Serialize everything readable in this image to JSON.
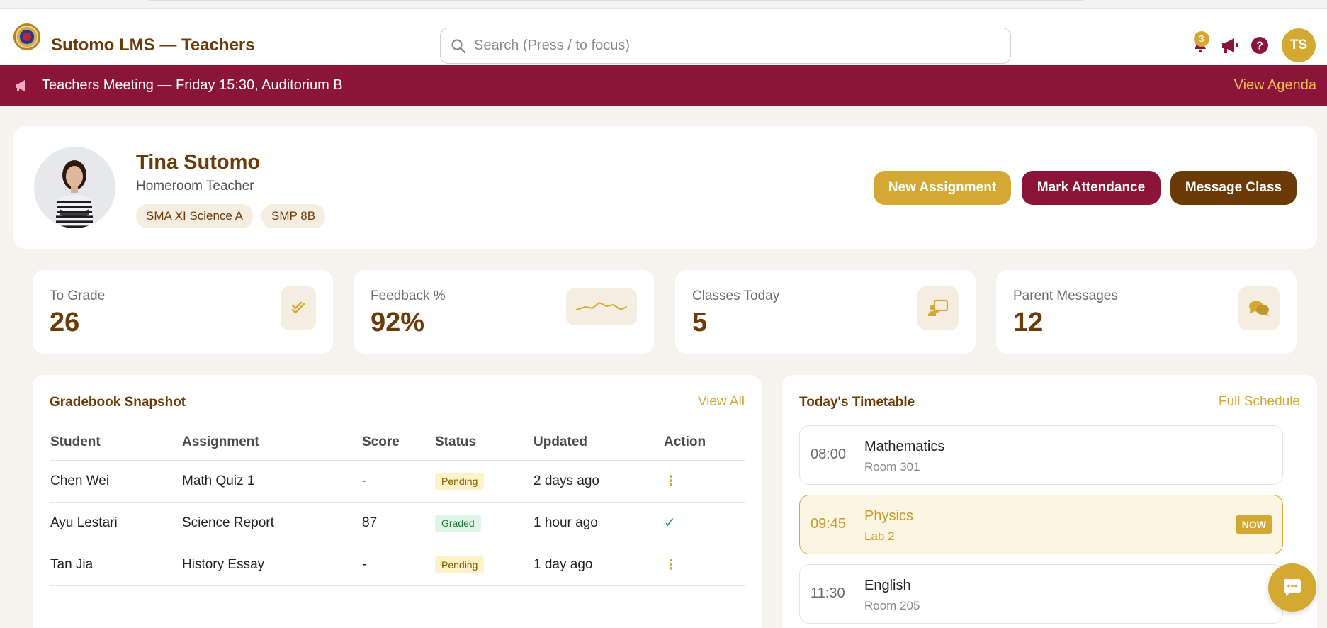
{
  "header": {
    "app_title": "Sutomo LMS — Teachers",
    "search_placeholder": "Search (Press / to focus)",
    "notification_count": "3",
    "user_initials": "TS"
  },
  "announcement": {
    "text": "Teachers Meeting — Friday 15:30, Auditorium B",
    "link": "View Agenda"
  },
  "profile": {
    "name": "Tina Sutomo",
    "role": "Homeroom Teacher",
    "classes": [
      "SMA XI Science A",
      "SMP 8B"
    ],
    "actions": {
      "new_assignment": "New Assignment",
      "mark_attendance": "Mark Attendance",
      "message_class": "Message Class"
    }
  },
  "stats": [
    {
      "label": "To Grade",
      "value": "26",
      "icon": "double-check-icon"
    },
    {
      "label": "Feedback %",
      "value": "92%",
      "icon": "sparkline-icon"
    },
    {
      "label": "Classes Today",
      "value": "5",
      "icon": "teacher-board-icon"
    },
    {
      "label": "Parent Messages",
      "value": "12",
      "icon": "chat-bubbles-icon"
    }
  ],
  "gradebook": {
    "title": "Gradebook Snapshot",
    "link": "View All",
    "columns": [
      "Student",
      "Assignment",
      "Score",
      "Status",
      "Updated",
      "Action"
    ],
    "rows": [
      {
        "student": "Chen Wei",
        "assignment": "Math Quiz 1",
        "score": "-",
        "status": "Pending",
        "updated": "2 days ago",
        "action": "kebab-icon"
      },
      {
        "student": "Ayu Lestari",
        "assignment": "Science Report",
        "score": "87",
        "status": "Graded",
        "updated": "1 hour ago",
        "action": "check-icon"
      },
      {
        "student": "Tan Jia",
        "assignment": "History Essay",
        "score": "-",
        "status": "Pending",
        "updated": "1 day ago",
        "action": "kebab-icon"
      }
    ]
  },
  "timetable": {
    "title": "Today's Timetable",
    "link": "Full Schedule",
    "slots": [
      {
        "time": "08:00",
        "subject": "Mathematics",
        "room": "Room 301"
      },
      {
        "time": "09:45",
        "subject": "Physics",
        "room": "Lab 2",
        "badge": "NOW"
      },
      {
        "time": "11:30",
        "subject": "English",
        "room": "Room 205"
      }
    ]
  },
  "colors": {
    "brand_brown": "#6b3a06",
    "accent_gold": "#d4a933",
    "maroon": "#8a1538",
    "background": "#f6f3ef"
  }
}
